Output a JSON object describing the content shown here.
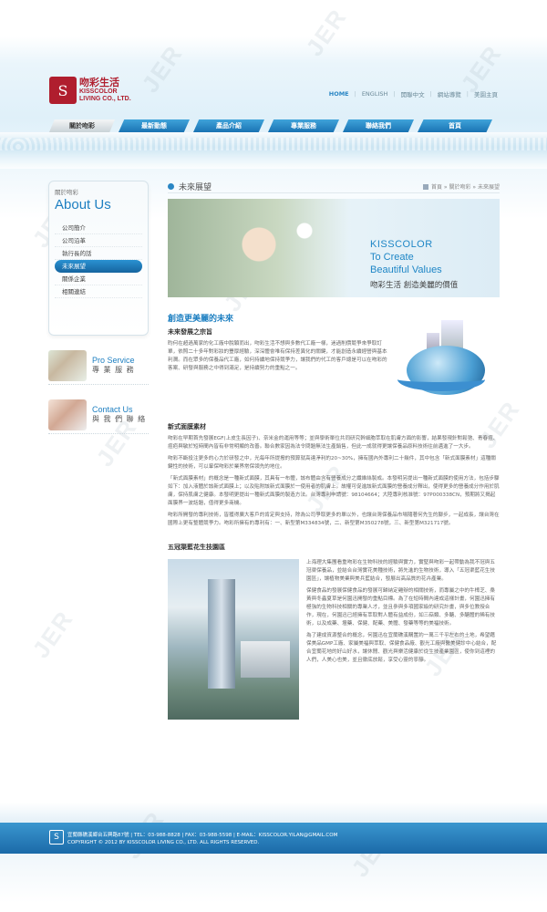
{
  "brand": {
    "name_cn": "吻彩生活",
    "name_en_1": "KISSCOLOR",
    "name_en_2": "LIVING CO., LTD."
  },
  "topnav": [
    "HOME",
    "ENGLISH",
    "開聯中文",
    "網站導覽",
    "美園主頁"
  ],
  "mainnav": [
    "關於吻彩",
    "最新動態",
    "產品介紹",
    "專業服務",
    "聯絡我們",
    "首頁"
  ],
  "sidebar": {
    "subtitle": "關於吻彩",
    "title": "About Us",
    "items": [
      "公司簡介",
      "公司沿革",
      "執行長的話",
      "未來展望",
      "關係企業",
      "相關連結"
    ],
    "promo1_en": "Pro Service",
    "promo1_cn": "專 業 服 務",
    "promo2_en": "Contact Us",
    "promo2_cn": "與 我 們 聯 絡"
  },
  "content": {
    "page_title": "未來展望",
    "breadcrumb": "首頁 » 關於吻彩 » 未來展望",
    "banner_l1": "KISSCOLOR",
    "banner_l2": "To Create",
    "banner_l3": "Beautiful Values",
    "banner_cn": "吻彩生活  創造美麗的價值",
    "section_title": "創造更美麗的未來",
    "sub1": "未來發展之宗旨",
    "para1": "昀何在超過萬家的化工廠中脫穎而出，吻彩生活不想與多數代工廠一樣，迷過削價競爭來爭取訂單，依照二十多年對彩妝的豐厚經驗，深深體會唯有保持差異化的關鍵，才能創造永續經營與基本利潤。而在眾多的保養品代工廠，如何持續地保持競爭力，讓我們的代工的客戶總是可以在吻彩的客案、研發與服務之中得到滿足，是持續努力的重點之一。",
    "sub2": "新式面膜素材",
    "para2": "吻彩在早期首先發展EGF(上皮生長因子)、奈米金的運用等等；並與學術單位共同研究幹細胞萃取在肌膚方面的影響，結果發現針對鬆弛、青春痘、痘疤與敏於短時間內皆有非常明顯的改善。聯合數家因為法令問題無法生產銷售，但此一成就得更讓保養品原料技術往前邁進了一大步。",
    "para3": "吻彩不斷投注更多的心力於研發之中，光每年所提撥的預算就高達淨利的20~30%，擁有國內外專利二十幾件，其中包含「新式面膜素材」這種關鍵性的技術，可以鞏保吻彩於業界常保領先的地位。",
    "para4": "「新式面膜素材」的概念是一種新式面膜，其具有一布體，該布體由含有營養成分之纖維絲製成。本發明另提出一種新式面膜的使用方法，包括步驟如下：加入液體於該新式面膜上；以及貼附該新式面膜於一使用者的肌膚上。故權可促進該新式面膜的營養成分釋出，使得更多的營養成分作用於肌膚，保持肌膚之健康。本發明更提出一種新式面膜的製造方法。台灣專利申請號：98104664；大陸專利核准號：97P000338CN，預期將又揭起面膜界一波話題，值得更多商機。",
    "para5": "吻彩所開發的專利技術，皆獲得廣大客戶的肯定與支持，除為公司爭取更多的單以外，也讓台灣保養品市場隨著何先生的腳步，一起成長，讓台灣在國際上更有整體競爭力。吻彩所擁有的專利有：一、新型第M334834號，二、新型第M350278號，三、新型第M321717號。",
    "sub3": "五冠渠藍花生技園區",
    "para6": "上海理大集團看重吻彩在生物科技的經驗與實力，實堅與吻彩一起帶動為我不冠與五冠渠保養品，並結合台灣實花美種技術，將先進的生物技術，導入「五冠渠藍花生技園區」，讓植物美業與美兵藍結合，發展出高品質的花卉產業。",
    "para7": "保健食品的發展保健食品的發展可歸納定雞辦的相關技術，而專屬之中的牛樟芝、桑黃與冬蟲夏草是何園迅開發的重點目標。為了在短時間內達成這樣計畫，何園迅擁有極強的生物科技相關的專業人才，並且參與多項國家級的研究計畫，與多位教授合作，現在，何園迅已經擁有萃取對人體有益成份，如三萜類、多醣、多醣體的稀有技術，以及成藥、壇藥、保健、配藥、美體、發藥等等的美福技術。",
    "para8": "為了建成資源整合的概念，何園迅在宜蘭礁溪購置約一萬三千平左右的土地，希望藉保美品GMP工廠、家屬美福與萃取、保健食品廠、觀光工廠與醫美健診中心結合，配合宜蘭花地的好山好水，讓休閒、觀光與樂活健康於從生技產業園區，使你到這裡的人們，人美心也美，並且徹底放鬆，享受心靈的寧靜。"
  },
  "footer": {
    "line1": "宜蘭縣礁溪鄉台五興路87號 | TEL：03-988-8828 | FAX：03-988-5598 | E-MAIL：KISSCOLOR.YILAN@GMAIL.COM",
    "line2": "COPYRIGHT © 2012 BY KISSCOLOR LIVING CO., LTD. ALL RIGHTS RESERVED."
  },
  "colors": {
    "brand_red": "#b01e2e",
    "accent_blue": "#1d7fc1",
    "footer_blue": "#2a80bd"
  },
  "icons": [
    "logo-mark",
    "home-icon",
    "title-dot-icon"
  ]
}
